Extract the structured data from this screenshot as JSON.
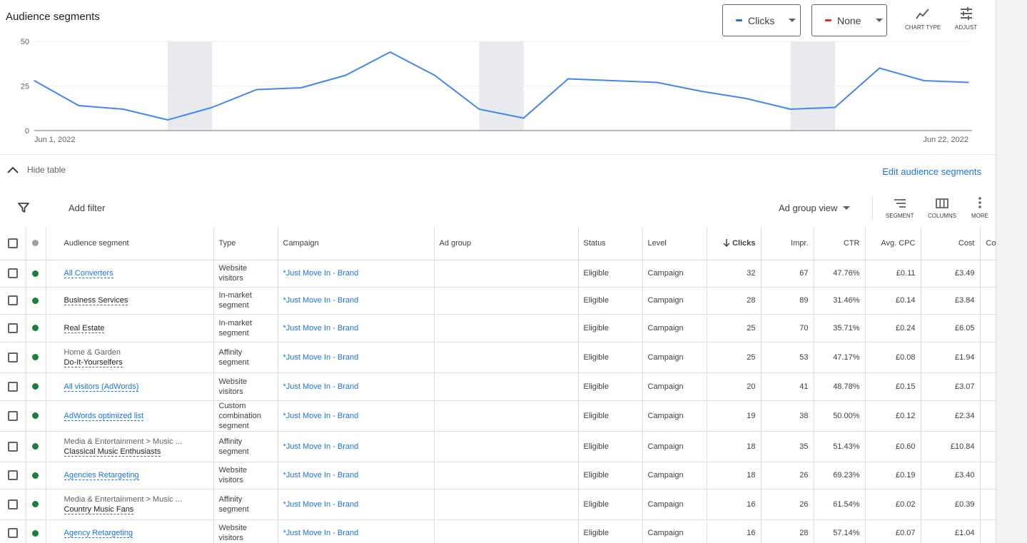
{
  "header": {
    "title": "Audience segments",
    "metric1": {
      "label": "Clicks",
      "color": "#1a73e8"
    },
    "metric2": {
      "label": "None",
      "color": "#d93025"
    },
    "chart_type_label": "CHART TYPE",
    "adjust_label": "ADJUST"
  },
  "chart_data": {
    "type": "line",
    "series": [
      {
        "name": "Clicks",
        "values": [
          28,
          14,
          12,
          6,
          13,
          23,
          24,
          31,
          44,
          31,
          12,
          7,
          29,
          28,
          27,
          22,
          18,
          12,
          13,
          35,
          28,
          27
        ]
      }
    ],
    "x_start_label": "Jun 1, 2022",
    "x_end_label": "Jun 22, 2022",
    "y_ticks": [
      "50",
      "25",
      "0"
    ],
    "ylim": [
      0,
      50
    ],
    "shaded_days_index": [
      4,
      11,
      18
    ],
    "line_color": "#4285f4"
  },
  "toolbar": {
    "hide_table": "Hide table",
    "edit_segments": "Edit audience segments",
    "add_filter": "Add filter",
    "view_select": "Ad group view",
    "segment_label": "SEGMENT",
    "columns_label": "COLUMNS",
    "more_label": "MORE"
  },
  "table": {
    "headers": {
      "segment": "Audience segment",
      "type": "Type",
      "campaign": "Campaign",
      "ad_group": "Ad group",
      "status": "Status",
      "level": "Level",
      "clicks": "Clicks",
      "impr": "Impr.",
      "ctr": "CTR",
      "cpc": "Avg. CPC",
      "cost": "Cost",
      "conv": "Co"
    },
    "rows": [
      {
        "path": "",
        "name": "All Converters",
        "linked": true,
        "type": [
          "Website",
          "visitors"
        ],
        "campaign": "*Just Move In - Brand",
        "ad_group": "",
        "status": "Eligible",
        "level": "Campaign",
        "clicks": "32",
        "impr": "67",
        "ctr": "47.76%",
        "cpc": "£0.11",
        "cost": "£3.49"
      },
      {
        "path": "",
        "name": "Business Services",
        "linked": false,
        "type": [
          "In-market",
          "segment"
        ],
        "campaign": "*Just Move In - Brand",
        "ad_group": "",
        "status": "Eligible",
        "level": "Campaign",
        "clicks": "28",
        "impr": "89",
        "ctr": "31.46%",
        "cpc": "£0.14",
        "cost": "£3.84"
      },
      {
        "path": "",
        "name": "Real Estate",
        "linked": false,
        "type": [
          "In-market",
          "segment"
        ],
        "campaign": "*Just Move In - Brand",
        "ad_group": "",
        "status": "Eligible",
        "level": "Campaign",
        "clicks": "25",
        "impr": "70",
        "ctr": "35.71%",
        "cpc": "£0.24",
        "cost": "£6.05"
      },
      {
        "path": "Home & Garden",
        "name": "Do-It-Yourselfers",
        "linked": false,
        "type": [
          "Affinity",
          "segment"
        ],
        "campaign": "*Just Move In - Brand",
        "ad_group": "",
        "status": "Eligible",
        "level": "Campaign",
        "clicks": "25",
        "impr": "53",
        "ctr": "47.17%",
        "cpc": "£0.08",
        "cost": "£1.94"
      },
      {
        "path": "",
        "name": "All visitors (AdWords)",
        "linked": true,
        "type": [
          "Website",
          "visitors"
        ],
        "campaign": "*Just Move In - Brand",
        "ad_group": "",
        "status": "Eligible",
        "level": "Campaign",
        "clicks": "20",
        "impr": "41",
        "ctr": "48.78%",
        "cpc": "£0.15",
        "cost": "£3.07"
      },
      {
        "path": "",
        "name": "AdWords optimized list",
        "linked": true,
        "type": [
          "Custom",
          "combination",
          "segment"
        ],
        "campaign": "*Just Move In - Brand",
        "ad_group": "",
        "status": "Eligible",
        "level": "Campaign",
        "clicks": "19",
        "impr": "38",
        "ctr": "50.00%",
        "cpc": "£0.12",
        "cost": "£2.34"
      },
      {
        "path": "Media & Entertainment > Music ...",
        "name": "Classical Music Enthusiasts",
        "linked": false,
        "type": [
          "Affinity",
          "segment"
        ],
        "campaign": "*Just Move In - Brand",
        "ad_group": "",
        "status": "Eligible",
        "level": "Campaign",
        "clicks": "18",
        "impr": "35",
        "ctr": "51.43%",
        "cpc": "£0.60",
        "cost": "£10.84"
      },
      {
        "path": "",
        "name": "Agencies Retargeting",
        "linked": true,
        "type": [
          "Website",
          "visitors"
        ],
        "campaign": "*Just Move In - Brand",
        "ad_group": "",
        "status": "Eligible",
        "level": "Campaign",
        "clicks": "18",
        "impr": "26",
        "ctr": "69.23%",
        "cpc": "£0.19",
        "cost": "£3.40"
      },
      {
        "path": "Media & Entertainment > Music ...",
        "name": "Country Music Fans",
        "linked": false,
        "type": [
          "Affinity",
          "segment"
        ],
        "campaign": "*Just Move In - Brand",
        "ad_group": "",
        "status": "Eligible",
        "level": "Campaign",
        "clicks": "16",
        "impr": "26",
        "ctr": "61.54%",
        "cpc": "£0.02",
        "cost": "£0.39"
      },
      {
        "path": "",
        "name": "Agency Retargeting",
        "linked": true,
        "type": [
          "Website",
          "visitors"
        ],
        "campaign": "*Just Move In - Brand",
        "ad_group": "",
        "status": "Eligible",
        "level": "Campaign",
        "clicks": "16",
        "impr": "28",
        "ctr": "57.14%",
        "cpc": "£0.07",
        "cost": "£1.04"
      }
    ]
  }
}
